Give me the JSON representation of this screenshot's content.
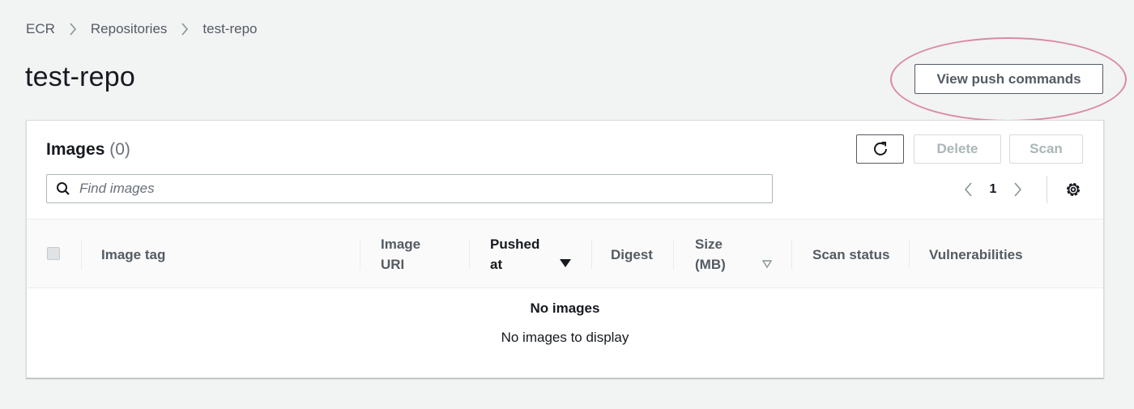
{
  "breadcrumb": {
    "items": [
      "ECR",
      "Repositories",
      "test-repo"
    ]
  },
  "page": {
    "title": "test-repo",
    "push_button_label": "View push commands"
  },
  "images_panel": {
    "title": "Images",
    "count": "(0)",
    "delete_label": "Delete",
    "scan_label": "Scan",
    "search_placeholder": "Find images",
    "current_page": "1",
    "columns": {
      "image_tag": "Image tag",
      "image_uri_1": "Image",
      "image_uri_2": "URI",
      "pushed_at_1": "Pushed",
      "pushed_at_2": "at",
      "digest": "Digest",
      "size_1": "Size",
      "size_2": "(MB)",
      "scan_status": "Scan status",
      "vulnerabilities": "Vulnerabilities"
    },
    "empty_title": "No images",
    "empty_message": "No images to display"
  },
  "icons": {
    "chevron": "chevron-right-icon",
    "refresh": "refresh-icon",
    "search": "search-icon",
    "pager_prev": "chevron-left-icon",
    "pager_next": "chevron-right-icon",
    "settings": "gear-icon",
    "sort_desc": "caret-down-icon",
    "sortable": "caret-down-outline-icon"
  },
  "colors": {
    "background": "#f2f3f3",
    "text": "#16191f",
    "muted": "#545b64",
    "disabled": "#aab7b8",
    "highlight": "#d98aa6"
  }
}
